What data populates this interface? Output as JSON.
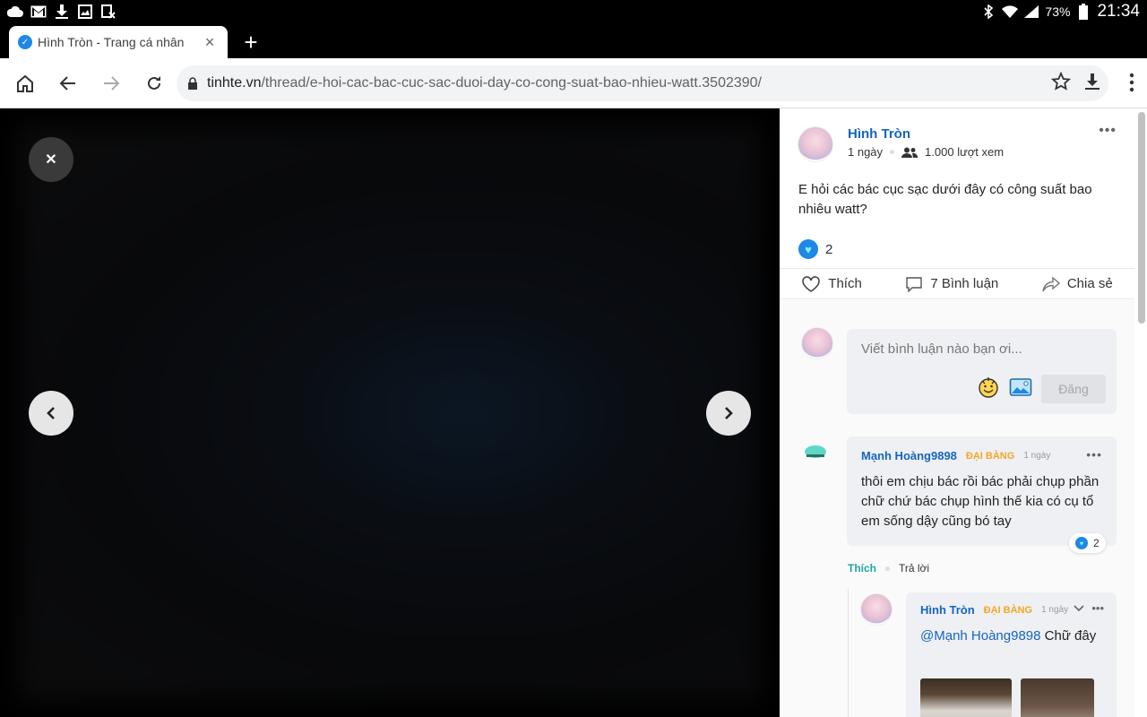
{
  "status_bar": {
    "battery": "73%",
    "time": "21:34"
  },
  "tab": {
    "title": "Hình Tròn - Trang cá nhân"
  },
  "address_bar": {
    "host": "tinhte.vn",
    "path": "/thread/e-hoi-cac-bac-cuc-sac-duoi-day-co-cong-suat-bao-nhieu-watt.3502390/"
  },
  "post": {
    "author": "Hình Tròn",
    "time": "1 ngày",
    "views": "1.000 lượt xem",
    "text": "E hỏi các bác cục sạc dưới đây có công suất bao nhiêu watt?",
    "reaction_count": "2",
    "actions": {
      "like": "Thích",
      "comment": "7 Bình luận",
      "share": "Chia sẻ"
    }
  },
  "comment_input": {
    "placeholder": "Viết bình luận nào bạn ơi...",
    "submit": "Đăng"
  },
  "comments": [
    {
      "author": "Mạnh Hoàng9898",
      "rank": "ĐẠI BÀNG",
      "time": "1 ngày",
      "text": "thôi em chịu bác rồi bác phải chụp phần chữ chứ bác chụp hình thế kia có cụ tổ em sống dậy cũng bó tay",
      "reaction_count": "2",
      "like": "Thích",
      "reply": "Trả lời"
    }
  ],
  "reply": {
    "author": "Hình Tròn",
    "rank": "ĐẠI BÀNG",
    "time": "1 ngày",
    "mention": "@Mạnh Hoàng9898",
    "text": " Chữ đây"
  },
  "colors": {
    "link_blue": "#1565c0",
    "rank_orange": "#f5a623",
    "like_teal": "#20a5a5",
    "reaction_blue": "#1e88e5"
  }
}
